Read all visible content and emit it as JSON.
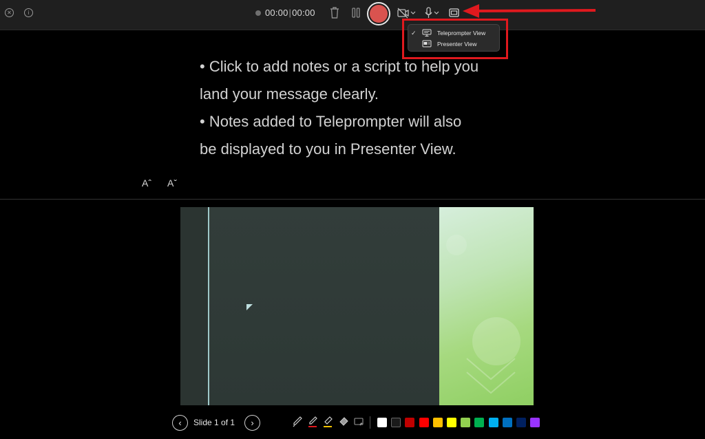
{
  "toolbar": {
    "timer_elapsed": "00:00",
    "timer_sep": "|",
    "timer_total": "00:00"
  },
  "view_menu": {
    "items": [
      {
        "label": "Teleprompter View",
        "checked": true,
        "check_mark": "✓"
      },
      {
        "label": "Presenter View",
        "checked": false,
        "check_mark": ""
      }
    ]
  },
  "notes": {
    "line1": "• Click to add notes or a script to help you",
    "line2": "land your message clearly.",
    "line3": "• Notes added to Teleprompter will also",
    "line4": "be displayed to you in Presenter View."
  },
  "font_controls": {
    "increase": "Aˆ",
    "decrease": "Aˇ"
  },
  "navigation": {
    "prev": "‹",
    "next": "›",
    "slide_label": "Slide 1 of 1"
  },
  "colors": {
    "swatches": [
      "#ffffff",
      "#1a1a1a",
      "#c00000",
      "#ff0000",
      "#ffc000",
      "#ffff00",
      "#92d050",
      "#00b050",
      "#00b0f0",
      "#0070c0",
      "#002060",
      "#9933ff"
    ],
    "record": "#d9534f",
    "annotation": "#e0191e"
  }
}
